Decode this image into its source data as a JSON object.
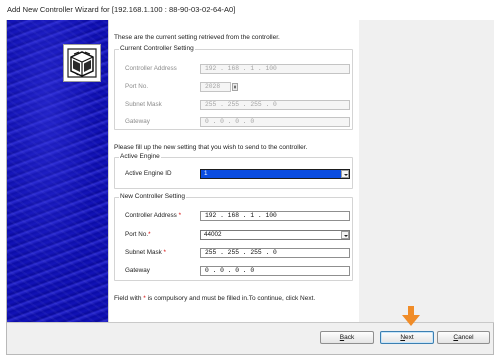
{
  "window": {
    "title": "Add New Controller Wizard for [192.168.1.100 : 88-90-03-02-64-A0]"
  },
  "intro_text": "These are the current setting retrieved from the controller.",
  "current_settings": {
    "legend": "Current Controller Setting",
    "address_label": "Controller Address",
    "address_value": "192 . 168 .  1  . 100",
    "port_label": "Port No.",
    "port_value": "2028",
    "subnet_label": "Subnet Mask",
    "subnet_value": "255 . 255 . 255 .  0",
    "gateway_label": "Gateway",
    "gateway_value": " 0  .  0  .  0  .  0"
  },
  "fill_text": "Please fill up the new setting that you wish to send to the controller.",
  "active_engine": {
    "legend": "Active Engine",
    "id_label": "Active Engine ID",
    "id_value": "1"
  },
  "new_settings": {
    "legend": "New Controller Setting",
    "address_label": "Controller Address",
    "address_value": "192 . 168 .  1  . 100",
    "port_label": "Port No.",
    "port_value": "44002",
    "subnet_label": "Subnet Mask",
    "subnet_value": "255 . 255 . 255 .  0",
    "gateway_label": "Gateway",
    "gateway_value": " 0  .  0  .  0  .  0",
    "required_mark": "*"
  },
  "footer_note": {
    "prefix": "Field with ",
    "mark": "*",
    "suffix": " is compulsory and must be filled in.To continue, click Next."
  },
  "buttons": {
    "back": {
      "mnemonic": "B",
      "rest": "ack"
    },
    "next": {
      "mnemonic": "N",
      "rest": "ext"
    },
    "cancel": {
      "mnemonic": "C",
      "rest": "ancel"
    }
  },
  "colors": {
    "banner": "#0d0db0",
    "selection": "#0b4de0",
    "required": "#d40000",
    "arrow": "#f08c28"
  },
  "icons": {
    "logo": "network-wizard-icon",
    "pointer": "down-arrow-icon"
  }
}
